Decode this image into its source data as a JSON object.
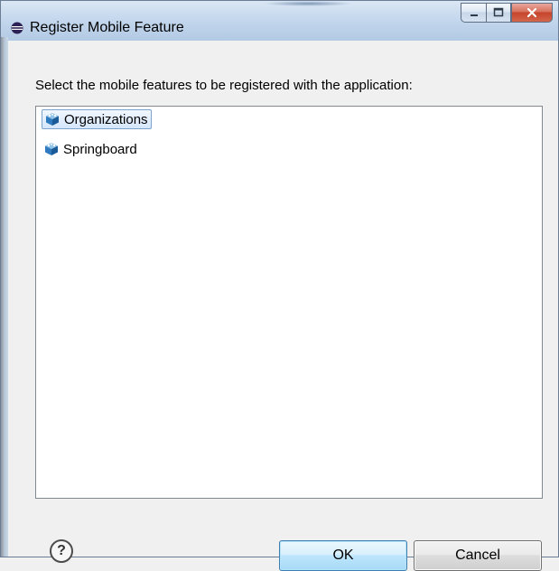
{
  "window": {
    "title": "Register Mobile Feature",
    "icon": "eclipse-icon"
  },
  "caption": {
    "minimize_icon": "minimize-icon",
    "maximize_icon": "maximize-icon",
    "close_icon": "close-icon"
  },
  "dialog": {
    "instruction": "Select the mobile features to be registered with the application:",
    "features": [
      {
        "label": "Organizations",
        "icon": "feature-cube-icon",
        "selected": true
      },
      {
        "label": "Springboard",
        "icon": "feature-cube-icon",
        "selected": false
      }
    ]
  },
  "buttons": {
    "help_glyph": "?",
    "ok_label": "OK",
    "cancel_label": "Cancel"
  },
  "colors": {
    "selection_border": "#7da2ce",
    "ok_border": "#3c7fb1",
    "close_red": "#c4442b"
  }
}
